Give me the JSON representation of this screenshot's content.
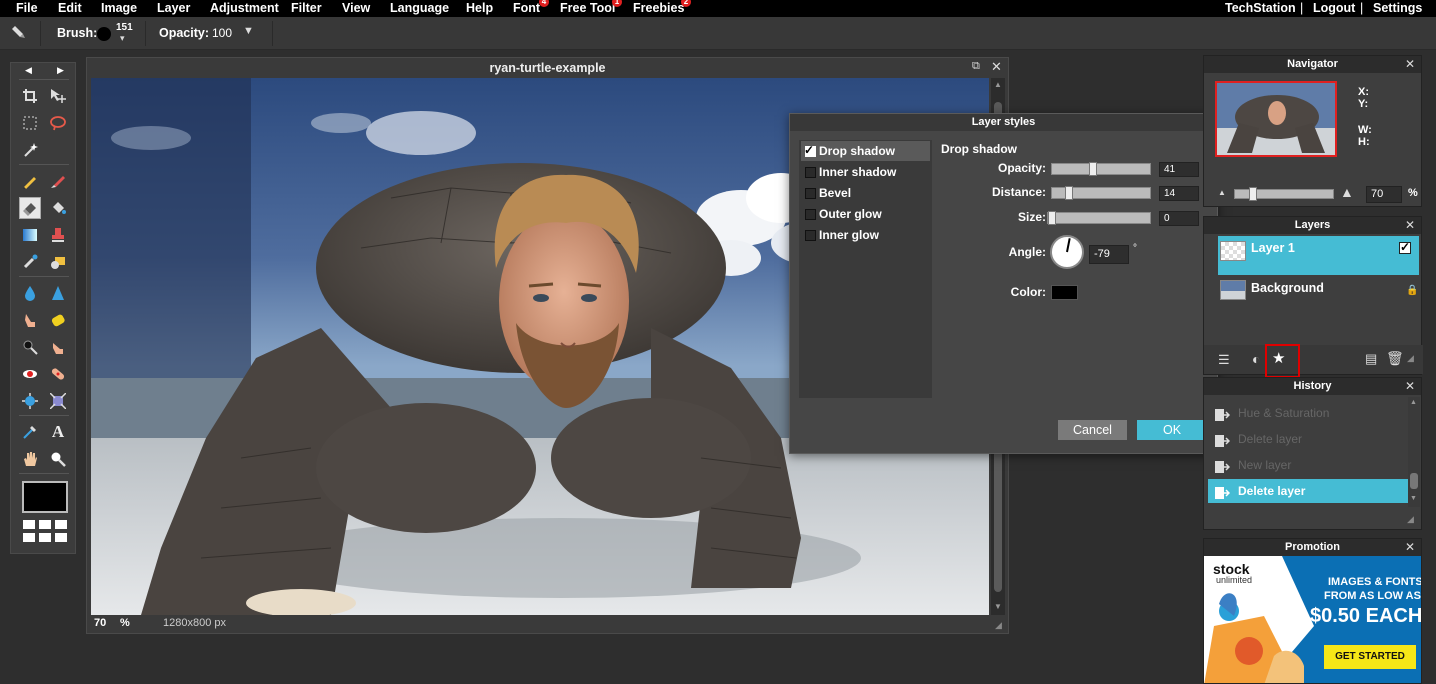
{
  "menu": {
    "items": [
      {
        "label": "File",
        "badge": ""
      },
      {
        "label": "Edit",
        "badge": ""
      },
      {
        "label": "Image",
        "badge": ""
      },
      {
        "label": "Layer",
        "badge": ""
      },
      {
        "label": "Adjustment",
        "badge": ""
      },
      {
        "label": "Filter",
        "badge": ""
      },
      {
        "label": "View",
        "badge": ""
      },
      {
        "label": "Language",
        "badge": ""
      },
      {
        "label": "Help",
        "badge": ""
      },
      {
        "label": "Font",
        "badge": "4"
      },
      {
        "label": "Free Tool",
        "badge": "1"
      },
      {
        "label": "Freebies",
        "badge": "2"
      }
    ],
    "right": {
      "user": "TechStation",
      "sep1": "|",
      "logout": "Logout",
      "sep2": "|",
      "settings": "Settings"
    }
  },
  "tool_options": {
    "brush_label": "Brush:",
    "brush_size": "151",
    "opacity_label": "Opacity:",
    "opacity_value": "100"
  },
  "document": {
    "title": "ryan-turtle-example",
    "zoom": "70",
    "zoom_unit": "%",
    "dimensions": "1280x800 px"
  },
  "layer_styles": {
    "title": "Layer styles",
    "styles": [
      {
        "label": "Drop shadow",
        "checked": true
      },
      {
        "label": "Inner shadow",
        "checked": false
      },
      {
        "label": "Bevel",
        "checked": false
      },
      {
        "label": "Outer glow",
        "checked": false
      },
      {
        "label": "Inner glow",
        "checked": false
      }
    ],
    "section_title": "Drop shadow",
    "opacity_label": "Opacity:",
    "opacity_value": "41",
    "opacity_fraction": 0.41,
    "distance_label": "Distance:",
    "distance_value": "14",
    "distance_fraction": 0.14,
    "size_label": "Size:",
    "size_value": "0",
    "size_fraction": 0,
    "angle_label": "Angle:",
    "angle_value": "-79",
    "angle_unit": "°",
    "color_label": "Color:",
    "color_value": "#000000",
    "cancel_label": "Cancel",
    "ok_label": "OK"
  },
  "navigator": {
    "title": "Navigator",
    "x_label": "X:",
    "y_label": "Y:",
    "w_label": "W:",
    "h_label": "H:",
    "zoom_value": "70",
    "zoom_unit": "%"
  },
  "layers": {
    "title": "Layers",
    "items": [
      {
        "name": "Layer 1",
        "selected": true
      },
      {
        "name": "Background",
        "locked": true
      }
    ]
  },
  "history": {
    "title": "History",
    "items": [
      {
        "label": "Hue & Saturation"
      },
      {
        "label": "Delete layer"
      },
      {
        "label": "New layer"
      },
      {
        "label": "Delete layer"
      }
    ]
  },
  "promotion": {
    "title": "Promotion",
    "brand_top": "stock",
    "brand_bottom": "unlimited",
    "line1": "IMAGES & FONTS",
    "line2": "FROM AS LOW AS",
    "price": "$0.50 EACH",
    "cta": "GET STARTED"
  },
  "colors": {
    "accent": "#45bcd4",
    "menu_bg": "#000000",
    "badge": "#e02020",
    "highlight_box": "#e00000",
    "promo_bg": "#0b6fb4",
    "promo_cta": "#f6e617"
  }
}
